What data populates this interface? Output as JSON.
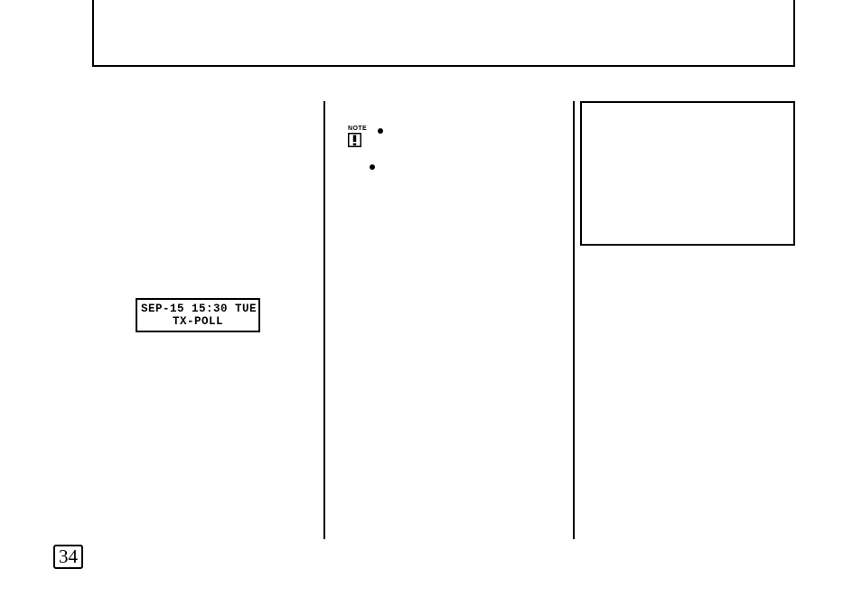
{
  "note": {
    "label": "NOTE"
  },
  "lcd": {
    "line1": "SEP-15 15:30 TUE",
    "line2": "TX-POLL"
  },
  "page_number": "34"
}
